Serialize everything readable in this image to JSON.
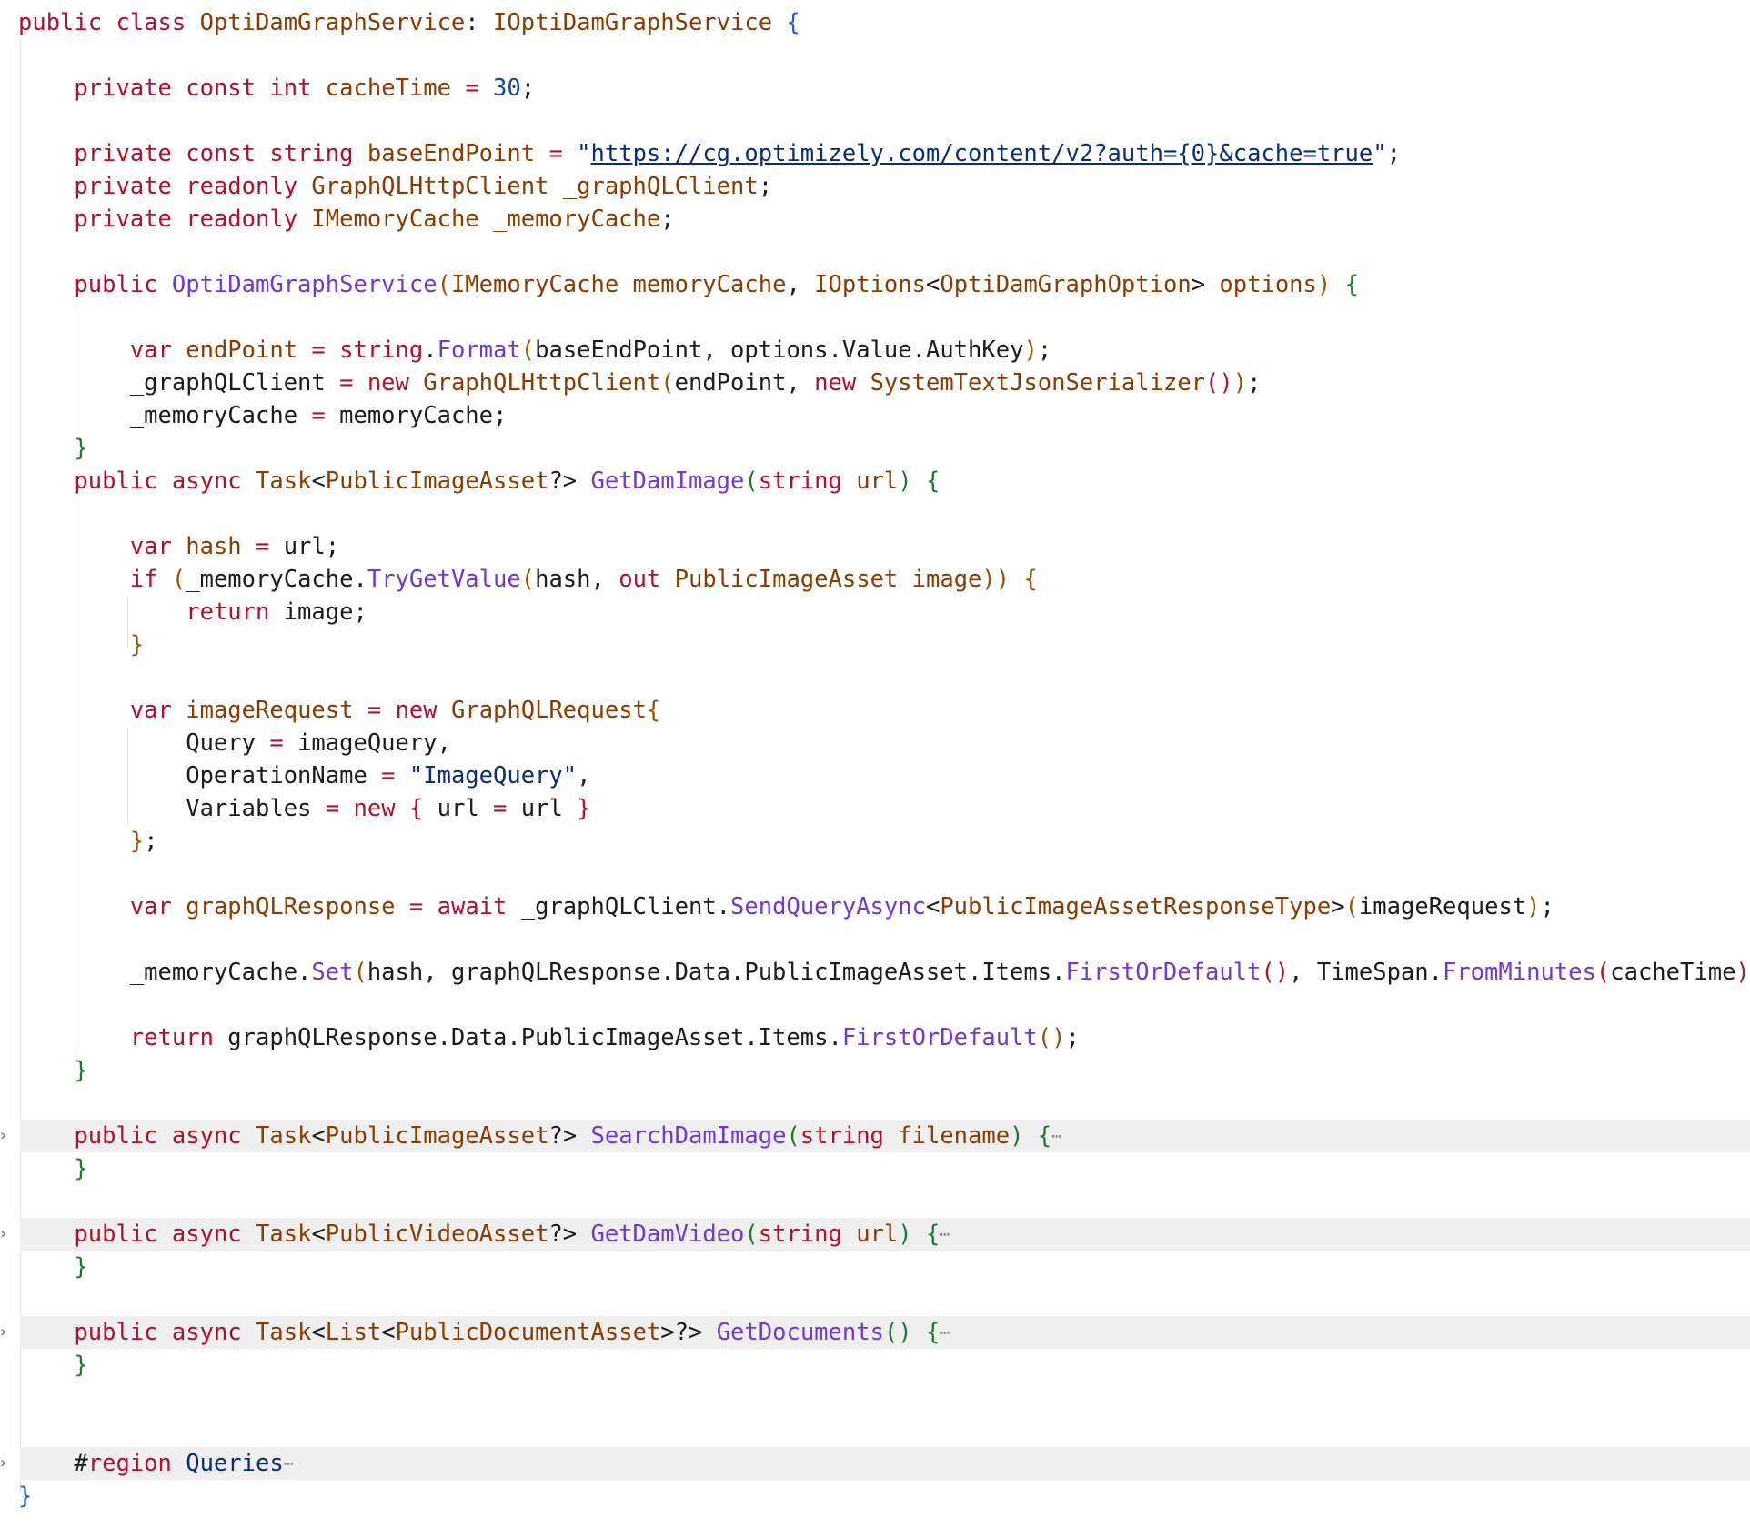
{
  "editor": {
    "language": "csharp",
    "lines": [
      {
        "tokens": [
          [
            "kw",
            "public "
          ],
          [
            "kw",
            "class "
          ],
          [
            "ty",
            "OptiDamGraphService"
          ],
          [
            "tx",
            ": "
          ],
          [
            "ty",
            "IOptiDamGraphService "
          ],
          [
            "pb",
            "{"
          ]
        ]
      },
      {
        "tokens": []
      },
      {
        "tokens": [
          [
            "tx",
            "    "
          ],
          [
            "kw",
            "private "
          ],
          [
            "kw",
            "const "
          ],
          [
            "kw",
            "int "
          ],
          [
            "ty",
            "cacheTime "
          ],
          [
            "op",
            "= "
          ],
          [
            "num",
            "30"
          ],
          [
            "tx",
            ";"
          ]
        ]
      },
      {
        "tokens": []
      },
      {
        "tokens": [
          [
            "tx",
            "    "
          ],
          [
            "kw",
            "private "
          ],
          [
            "kw",
            "const "
          ],
          [
            "kw",
            "string "
          ],
          [
            "ty",
            "baseEndPoint "
          ],
          [
            "op",
            "= "
          ],
          [
            "str",
            "\""
          ],
          [
            "url",
            "https://cg.optimizely.com/content/v2?auth={0}&cache=true"
          ],
          [
            "str",
            "\""
          ],
          [
            "tx",
            ";"
          ]
        ]
      },
      {
        "tokens": [
          [
            "tx",
            "    "
          ],
          [
            "kw",
            "private "
          ],
          [
            "kw",
            "readonly "
          ],
          [
            "ty",
            "GraphQLHttpClient "
          ],
          [
            "ty",
            "_graphQLClient"
          ],
          [
            "tx",
            ";"
          ]
        ]
      },
      {
        "tokens": [
          [
            "tx",
            "    "
          ],
          [
            "kw",
            "private "
          ],
          [
            "kw",
            "readonly "
          ],
          [
            "ty",
            "IMemoryCache "
          ],
          [
            "ty",
            "_memoryCache"
          ],
          [
            "tx",
            ";"
          ]
        ]
      },
      {
        "tokens": []
      },
      {
        "tokens": [
          [
            "tx",
            "    "
          ],
          [
            "kw",
            "public "
          ],
          [
            "fn",
            "OptiDamGraphService"
          ],
          [
            "pu",
            "("
          ],
          [
            "ty",
            "IMemoryCache "
          ],
          [
            "ty",
            "memoryCache"
          ],
          [
            "tx",
            ", "
          ],
          [
            "ty",
            "IOptions"
          ],
          [
            "tx",
            "<"
          ],
          [
            "ty",
            "OptiDamGraphOption"
          ],
          [
            "tx",
            "> "
          ],
          [
            "ty",
            "options"
          ],
          [
            "pu",
            ") "
          ],
          [
            "pg",
            "{"
          ]
        ]
      },
      {
        "tokens": []
      },
      {
        "tokens": [
          [
            "tx",
            "        "
          ],
          [
            "kw",
            "var "
          ],
          [
            "ty",
            "endPoint "
          ],
          [
            "op",
            "= "
          ],
          [
            "kw",
            "string"
          ],
          [
            "tx",
            "."
          ],
          [
            "fn",
            "Format"
          ],
          [
            "pu",
            "("
          ],
          [
            "tx",
            "baseEndPoint, options.Value.AuthKey"
          ],
          [
            "pu",
            ")"
          ],
          [
            "tx",
            ";"
          ]
        ]
      },
      {
        "tokens": [
          [
            "tx",
            "        _graphQLClient "
          ],
          [
            "op",
            "= "
          ],
          [
            "kw",
            "new "
          ],
          [
            "ty",
            "GraphQLHttpClient"
          ],
          [
            "pu",
            "("
          ],
          [
            "tx",
            "endPoint, "
          ],
          [
            "kw",
            "new "
          ],
          [
            "ty",
            "SystemTextJsonSerializer"
          ],
          [
            "pl",
            "()"
          ],
          [
            "pu",
            ")"
          ],
          [
            "tx",
            ";"
          ]
        ]
      },
      {
        "tokens": [
          [
            "tx",
            "        _memoryCache "
          ],
          [
            "op",
            "= "
          ],
          [
            "tx",
            "memoryCache;"
          ]
        ]
      },
      {
        "tokens": [
          [
            "tx",
            "    "
          ],
          [
            "pg",
            "}"
          ]
        ]
      },
      {
        "tokens": [
          [
            "tx",
            "    "
          ],
          [
            "kw",
            "public "
          ],
          [
            "kw",
            "async "
          ],
          [
            "ty",
            "Task"
          ],
          [
            "tx",
            "<"
          ],
          [
            "ty",
            "PublicImageAsset"
          ],
          [
            "tx",
            "?> "
          ],
          [
            "fn",
            "GetDamImage"
          ],
          [
            "pg",
            "("
          ],
          [
            "kw",
            "string "
          ],
          [
            "ty",
            "url"
          ],
          [
            "pg",
            ") {"
          ]
        ]
      },
      {
        "tokens": []
      },
      {
        "tokens": [
          [
            "tx",
            "        "
          ],
          [
            "kw",
            "var "
          ],
          [
            "ty",
            "hash "
          ],
          [
            "op",
            "= "
          ],
          [
            "tx",
            "url;"
          ]
        ]
      },
      {
        "tokens": [
          [
            "tx",
            "        "
          ],
          [
            "kw",
            "if "
          ],
          [
            "pu",
            "("
          ],
          [
            "tx",
            "_memoryCache."
          ],
          [
            "fn",
            "TryGetValue"
          ],
          [
            "pu",
            "("
          ],
          [
            "tx",
            "hash, "
          ],
          [
            "kw",
            "out "
          ],
          [
            "ty",
            "PublicImageAsset "
          ],
          [
            "ty",
            "image"
          ],
          [
            "pu",
            ")) {"
          ]
        ]
      },
      {
        "tokens": [
          [
            "tx",
            "            "
          ],
          [
            "kw",
            "return "
          ],
          [
            "tx",
            "image;"
          ]
        ]
      },
      {
        "tokens": [
          [
            "tx",
            "        "
          ],
          [
            "pu",
            "}"
          ]
        ]
      },
      {
        "tokens": []
      },
      {
        "tokens": [
          [
            "tx",
            "        "
          ],
          [
            "kw",
            "var "
          ],
          [
            "ty",
            "imageRequest "
          ],
          [
            "op",
            "= "
          ],
          [
            "kw",
            "new "
          ],
          [
            "ty",
            "GraphQLRequest"
          ],
          [
            "pu",
            "{"
          ]
        ]
      },
      {
        "tokens": [
          [
            "tx",
            "            Query "
          ],
          [
            "op",
            "= "
          ],
          [
            "tx",
            "imageQuery,"
          ]
        ]
      },
      {
        "tokens": [
          [
            "tx",
            "            OperationName "
          ],
          [
            "op",
            "= "
          ],
          [
            "str",
            "\"ImageQuery\""
          ],
          [
            "tx",
            ","
          ]
        ]
      },
      {
        "tokens": [
          [
            "tx",
            "            Variables "
          ],
          [
            "op",
            "= "
          ],
          [
            "kw",
            "new "
          ],
          [
            "pl",
            "{ "
          ],
          [
            "tx",
            "url "
          ],
          [
            "op",
            "= "
          ],
          [
            "tx",
            "url "
          ],
          [
            "pl",
            "}"
          ]
        ]
      },
      {
        "tokens": [
          [
            "tx",
            "        "
          ],
          [
            "pu",
            "}"
          ],
          [
            "tx",
            ";"
          ]
        ]
      },
      {
        "tokens": []
      },
      {
        "tokens": [
          [
            "tx",
            "        "
          ],
          [
            "kw",
            "var "
          ],
          [
            "ty",
            "graphQLResponse "
          ],
          [
            "op",
            "= "
          ],
          [
            "kw",
            "await "
          ],
          [
            "tx",
            "_graphQLClient."
          ],
          [
            "fn",
            "SendQueryAsync"
          ],
          [
            "tx",
            "<"
          ],
          [
            "ty",
            "PublicImageAssetResponseType"
          ],
          [
            "tx",
            ">"
          ],
          [
            "pu",
            "("
          ],
          [
            "tx",
            "imageRequest"
          ],
          [
            "pu",
            ")"
          ],
          [
            "tx",
            ";"
          ]
        ]
      },
      {
        "tokens": []
      },
      {
        "tokens": [
          [
            "tx",
            "        _memoryCache."
          ],
          [
            "fn",
            "Set"
          ],
          [
            "pu",
            "("
          ],
          [
            "tx",
            "hash, graphQLResponse.Data.PublicImageAsset.Items."
          ],
          [
            "fn",
            "FirstOrDefault"
          ],
          [
            "pl",
            "()"
          ],
          [
            "tx",
            ", TimeSpan."
          ],
          [
            "fn",
            "FromMinutes"
          ],
          [
            "pl",
            "("
          ],
          [
            "tx",
            "cacheTime"
          ],
          [
            "pl",
            ")"
          ],
          [
            "pu",
            ")"
          ],
          [
            "tx",
            ";"
          ]
        ]
      },
      {
        "tokens": []
      },
      {
        "tokens": [
          [
            "tx",
            "        "
          ],
          [
            "kw",
            "return "
          ],
          [
            "tx",
            "graphQLResponse.Data.PublicImageAsset.Items."
          ],
          [
            "fn",
            "FirstOrDefault"
          ],
          [
            "pu",
            "()"
          ],
          [
            "tx",
            ";"
          ]
        ]
      },
      {
        "tokens": [
          [
            "tx",
            "    "
          ],
          [
            "pg",
            "}"
          ]
        ]
      },
      {
        "tokens": []
      },
      {
        "folded": true,
        "tokens": [
          [
            "tx",
            "    "
          ],
          [
            "kw",
            "public "
          ],
          [
            "kw",
            "async "
          ],
          [
            "ty",
            "Task"
          ],
          [
            "tx",
            "<"
          ],
          [
            "ty",
            "PublicImageAsset"
          ],
          [
            "tx",
            "?> "
          ],
          [
            "fn",
            "SearchDamImage"
          ],
          [
            "pg",
            "("
          ],
          [
            "kw",
            "string "
          ],
          [
            "ty",
            "filename"
          ],
          [
            "pg",
            ") {"
          ]
        ],
        "ellipsis": "⋯"
      },
      {
        "tokens": [
          [
            "tx",
            "    "
          ],
          [
            "pg",
            "}"
          ]
        ]
      },
      {
        "tokens": []
      },
      {
        "folded": true,
        "tokens": [
          [
            "tx",
            "    "
          ],
          [
            "kw",
            "public "
          ],
          [
            "kw",
            "async "
          ],
          [
            "ty",
            "Task"
          ],
          [
            "tx",
            "<"
          ],
          [
            "ty",
            "PublicVideoAsset"
          ],
          [
            "tx",
            "?> "
          ],
          [
            "fn",
            "GetDamVideo"
          ],
          [
            "pg",
            "("
          ],
          [
            "kw",
            "string "
          ],
          [
            "ty",
            "url"
          ],
          [
            "pg",
            ") {"
          ]
        ],
        "ellipsis": "⋯"
      },
      {
        "tokens": [
          [
            "tx",
            "    "
          ],
          [
            "pg",
            "}"
          ]
        ]
      },
      {
        "tokens": []
      },
      {
        "folded": true,
        "tokens": [
          [
            "tx",
            "    "
          ],
          [
            "kw",
            "public "
          ],
          [
            "kw",
            "async "
          ],
          [
            "ty",
            "Task"
          ],
          [
            "tx",
            "<"
          ],
          [
            "ty",
            "List"
          ],
          [
            "tx",
            "<"
          ],
          [
            "ty",
            "PublicDocumentAsset"
          ],
          [
            "tx",
            ">?> "
          ],
          [
            "fn",
            "GetDocuments"
          ],
          [
            "pg",
            "() {"
          ]
        ],
        "ellipsis": "⋯"
      },
      {
        "tokens": [
          [
            "tx",
            "    "
          ],
          [
            "pg",
            "}"
          ]
        ]
      },
      {
        "tokens": []
      },
      {
        "tokens": []
      },
      {
        "folded": true,
        "tokens": [
          [
            "tx",
            "    #"
          ],
          [
            "kw",
            "region "
          ],
          [
            "str",
            "Queries"
          ]
        ],
        "ellipsis": "⋯"
      },
      {
        "tokens": [
          [
            "pb",
            "}"
          ]
        ]
      }
    ]
  }
}
